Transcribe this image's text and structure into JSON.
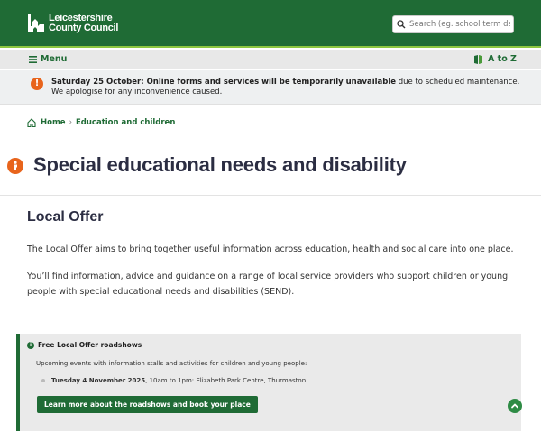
{
  "header": {
    "logo_line1": "Leicestershire",
    "logo_line2": "County Council",
    "search_placeholder": "Search (eg. school term dates)"
  },
  "nav": {
    "menu_label": "Menu",
    "atoz_label": "A to Z"
  },
  "alert": {
    "bold_text": "Saturday 25 October: Online forms and services will be temporarily unavailable",
    "rest_text": " due to scheduled maintenance. We apologise for any inconvenience caused."
  },
  "breadcrumb": {
    "home": "Home",
    "current": "Education and children"
  },
  "page": {
    "title": "Special educational needs and disability",
    "section_title": "Local Offer",
    "para1": "The Local Offer aims to bring together useful information across education, health and social care into one place.",
    "para2": "You’ll find information, advice and guidance on a range of local service providers who support children or young people with special educational needs and disabilities (SEND)."
  },
  "callout": {
    "title": "Free Local Offer roadshows",
    "subtitle": "Upcoming events with information stalls and activities for children and young people:",
    "event_date": "Tuesday 4 November 2025",
    "event_detail": ", 10am to 1pm: Elizabeth Park Centre, Thurmaston",
    "button_label": "Learn more about the roadshows and book your place"
  },
  "colors": {
    "brand_green": "#1f6b35",
    "accent_lime": "#8cc63f",
    "alert_orange": "#e8641c"
  },
  "icons": [
    "logo-icon",
    "search-icon",
    "menu-icon",
    "book-icon",
    "alert-icon",
    "home-icon",
    "section-icon",
    "info-icon",
    "back-to-top-icon"
  ]
}
